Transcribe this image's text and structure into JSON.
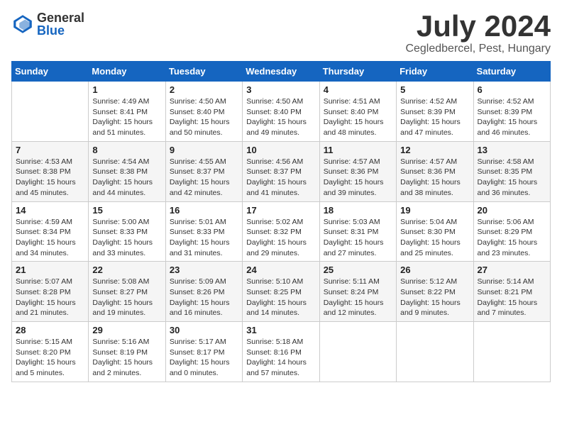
{
  "header": {
    "logo_general": "General",
    "logo_blue": "Blue",
    "title": "July 2024",
    "subtitle": "Cegledbercel, Pest, Hungary"
  },
  "weekdays": [
    "Sunday",
    "Monday",
    "Tuesday",
    "Wednesday",
    "Thursday",
    "Friday",
    "Saturday"
  ],
  "weeks": [
    [
      {
        "day": "",
        "info": ""
      },
      {
        "day": "1",
        "info": "Sunrise: 4:49 AM\nSunset: 8:41 PM\nDaylight: 15 hours\nand 51 minutes."
      },
      {
        "day": "2",
        "info": "Sunrise: 4:50 AM\nSunset: 8:40 PM\nDaylight: 15 hours\nand 50 minutes."
      },
      {
        "day": "3",
        "info": "Sunrise: 4:50 AM\nSunset: 8:40 PM\nDaylight: 15 hours\nand 49 minutes."
      },
      {
        "day": "4",
        "info": "Sunrise: 4:51 AM\nSunset: 8:40 PM\nDaylight: 15 hours\nand 48 minutes."
      },
      {
        "day": "5",
        "info": "Sunrise: 4:52 AM\nSunset: 8:39 PM\nDaylight: 15 hours\nand 47 minutes."
      },
      {
        "day": "6",
        "info": "Sunrise: 4:52 AM\nSunset: 8:39 PM\nDaylight: 15 hours\nand 46 minutes."
      }
    ],
    [
      {
        "day": "7",
        "info": "Sunrise: 4:53 AM\nSunset: 8:38 PM\nDaylight: 15 hours\nand 45 minutes."
      },
      {
        "day": "8",
        "info": "Sunrise: 4:54 AM\nSunset: 8:38 PM\nDaylight: 15 hours\nand 44 minutes."
      },
      {
        "day": "9",
        "info": "Sunrise: 4:55 AM\nSunset: 8:37 PM\nDaylight: 15 hours\nand 42 minutes."
      },
      {
        "day": "10",
        "info": "Sunrise: 4:56 AM\nSunset: 8:37 PM\nDaylight: 15 hours\nand 41 minutes."
      },
      {
        "day": "11",
        "info": "Sunrise: 4:57 AM\nSunset: 8:36 PM\nDaylight: 15 hours\nand 39 minutes."
      },
      {
        "day": "12",
        "info": "Sunrise: 4:57 AM\nSunset: 8:36 PM\nDaylight: 15 hours\nand 38 minutes."
      },
      {
        "day": "13",
        "info": "Sunrise: 4:58 AM\nSunset: 8:35 PM\nDaylight: 15 hours\nand 36 minutes."
      }
    ],
    [
      {
        "day": "14",
        "info": "Sunrise: 4:59 AM\nSunset: 8:34 PM\nDaylight: 15 hours\nand 34 minutes."
      },
      {
        "day": "15",
        "info": "Sunrise: 5:00 AM\nSunset: 8:33 PM\nDaylight: 15 hours\nand 33 minutes."
      },
      {
        "day": "16",
        "info": "Sunrise: 5:01 AM\nSunset: 8:33 PM\nDaylight: 15 hours\nand 31 minutes."
      },
      {
        "day": "17",
        "info": "Sunrise: 5:02 AM\nSunset: 8:32 PM\nDaylight: 15 hours\nand 29 minutes."
      },
      {
        "day": "18",
        "info": "Sunrise: 5:03 AM\nSunset: 8:31 PM\nDaylight: 15 hours\nand 27 minutes."
      },
      {
        "day": "19",
        "info": "Sunrise: 5:04 AM\nSunset: 8:30 PM\nDaylight: 15 hours\nand 25 minutes."
      },
      {
        "day": "20",
        "info": "Sunrise: 5:06 AM\nSunset: 8:29 PM\nDaylight: 15 hours\nand 23 minutes."
      }
    ],
    [
      {
        "day": "21",
        "info": "Sunrise: 5:07 AM\nSunset: 8:28 PM\nDaylight: 15 hours\nand 21 minutes."
      },
      {
        "day": "22",
        "info": "Sunrise: 5:08 AM\nSunset: 8:27 PM\nDaylight: 15 hours\nand 19 minutes."
      },
      {
        "day": "23",
        "info": "Sunrise: 5:09 AM\nSunset: 8:26 PM\nDaylight: 15 hours\nand 16 minutes."
      },
      {
        "day": "24",
        "info": "Sunrise: 5:10 AM\nSunset: 8:25 PM\nDaylight: 15 hours\nand 14 minutes."
      },
      {
        "day": "25",
        "info": "Sunrise: 5:11 AM\nSunset: 8:24 PM\nDaylight: 15 hours\nand 12 minutes."
      },
      {
        "day": "26",
        "info": "Sunrise: 5:12 AM\nSunset: 8:22 PM\nDaylight: 15 hours\nand 9 minutes."
      },
      {
        "day": "27",
        "info": "Sunrise: 5:14 AM\nSunset: 8:21 PM\nDaylight: 15 hours\nand 7 minutes."
      }
    ],
    [
      {
        "day": "28",
        "info": "Sunrise: 5:15 AM\nSunset: 8:20 PM\nDaylight: 15 hours\nand 5 minutes."
      },
      {
        "day": "29",
        "info": "Sunrise: 5:16 AM\nSunset: 8:19 PM\nDaylight: 15 hours\nand 2 minutes."
      },
      {
        "day": "30",
        "info": "Sunrise: 5:17 AM\nSunset: 8:17 PM\nDaylight: 15 hours\nand 0 minutes."
      },
      {
        "day": "31",
        "info": "Sunrise: 5:18 AM\nSunset: 8:16 PM\nDaylight: 14 hours\nand 57 minutes."
      },
      {
        "day": "",
        "info": ""
      },
      {
        "day": "",
        "info": ""
      },
      {
        "day": "",
        "info": ""
      }
    ]
  ]
}
